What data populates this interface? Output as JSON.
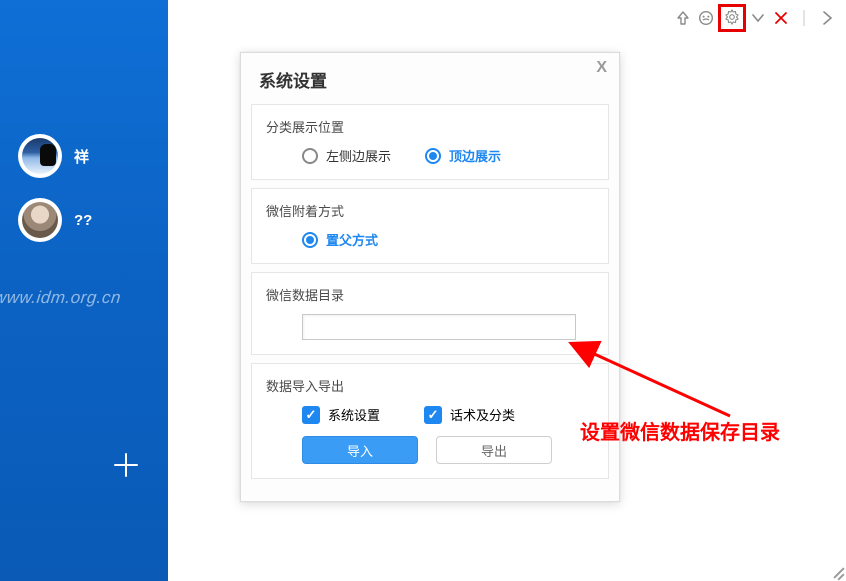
{
  "sidebar": {
    "contacts": [
      {
        "name": "祥"
      },
      {
        "name": "??"
      }
    ],
    "watermark": "www.idm.org.cn"
  },
  "modal": {
    "title": "系统设置",
    "close_glyph": "X",
    "sections": {
      "display_position": {
        "title": "分类展示位置",
        "options": {
          "left": {
            "label": "左侧边展示",
            "checked": false
          },
          "top": {
            "label": "顶边展示",
            "checked": true
          }
        }
      },
      "attach_mode": {
        "title": "微信附着方式",
        "options": {
          "parent": {
            "label": "置父方式",
            "checked": true
          }
        }
      },
      "data_dir": {
        "title": "微信数据目录",
        "value": ""
      },
      "import_export": {
        "title": "数据导入导出",
        "checks": {
          "sys": {
            "label": "系统设置",
            "checked": true
          },
          "group": {
            "label": "话术及分类",
            "checked": true
          }
        },
        "buttons": {
          "import": "导入",
          "export": "导出"
        }
      }
    }
  },
  "annotation": {
    "text": "设置微信数据保存目录"
  }
}
